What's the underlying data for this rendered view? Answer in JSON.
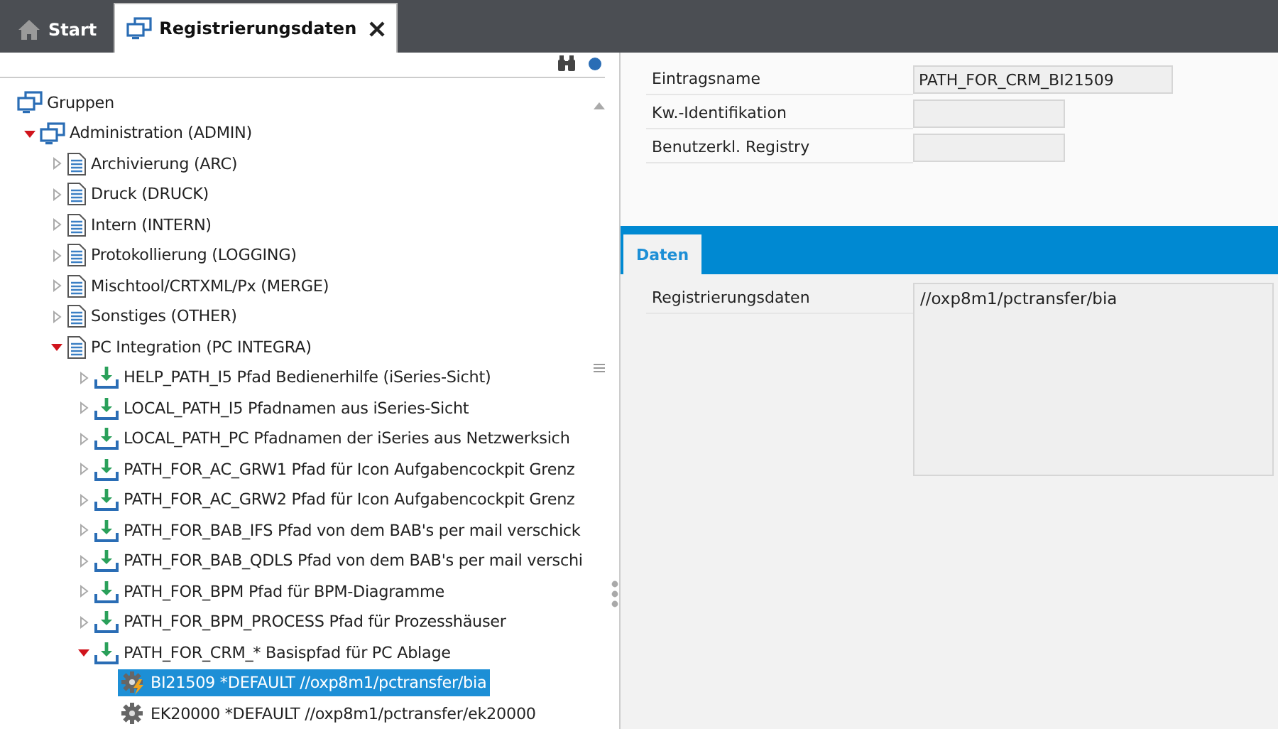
{
  "tabs": [
    {
      "label": "Start",
      "kind": "home",
      "selected": false,
      "closable": false
    },
    {
      "label": "Registrierungsdaten",
      "kind": "group",
      "selected": true,
      "closable": true
    }
  ],
  "tree": [
    {
      "label": "Gruppen",
      "kind": "group",
      "children": [
        {
          "label": "Administration (ADMIN)",
          "kind": "group",
          "expanded": true,
          "children": [
            {
              "label": "Archivierung (ARC)",
              "kind": "doc",
              "expanded": false
            },
            {
              "label": "Druck (DRUCK)",
              "kind": "doc",
              "expanded": false
            },
            {
              "label": "Intern (INTERN)",
              "kind": "doc",
              "expanded": false
            },
            {
              "label": "Protokollierung (LOGGING)",
              "kind": "doc",
              "expanded": false
            },
            {
              "label": "Mischtool/CRTXML/Px (MERGE)",
              "kind": "doc",
              "expanded": false
            },
            {
              "label": "Sonstiges (OTHER)",
              "kind": "doc",
              "expanded": false
            },
            {
              "label": "PC Integration (PC INTEGRA)",
              "kind": "doc",
              "expanded": true,
              "children": [
                {
                  "label": "HELP_PATH_I5 Pfad Bedienerhilfe (iSeries-Sicht)",
                  "kind": "download",
                  "expanded": false
                },
                {
                  "label": "LOCAL_PATH_I5 Pfadnamen aus iSeries-Sicht",
                  "kind": "download",
                  "expanded": false
                },
                {
                  "label": "LOCAL_PATH_PC Pfadnamen der iSeries aus Netzwerksich",
                  "kind": "download",
                  "expanded": false
                },
                {
                  "label": "PATH_FOR_AC_GRW1 Pfad für Icon Aufgabencockpit Grenz",
                  "kind": "download",
                  "expanded": false
                },
                {
                  "label": "PATH_FOR_AC_GRW2 Pfad für Icon Aufgabencockpit Grenz",
                  "kind": "download",
                  "expanded": false
                },
                {
                  "label": "PATH_FOR_BAB_IFS Pfad von dem BAB's per mail verschick",
                  "kind": "download",
                  "expanded": false
                },
                {
                  "label": "PATH_FOR_BAB_QDLS Pfad von dem BAB's per mail verschi",
                  "kind": "download",
                  "expanded": false
                },
                {
                  "label": "PATH_FOR_BPM Pfad für BPM-Diagramme",
                  "kind": "download",
                  "expanded": false
                },
                {
                  "label": "PATH_FOR_BPM_PROCESS Pfad für Prozesshäuser",
                  "kind": "download",
                  "expanded": false
                },
                {
                  "label": "PATH_FOR_CRM_* Basispfad für PC Ablage",
                  "kind": "download",
                  "expanded": true,
                  "children": [
                    {
                      "label": "BI21509 *DEFAULT //oxp8m1/pctransfer/bia",
                      "kind": "gear-active",
                      "selected": true
                    },
                    {
                      "label": "EK20000 *DEFAULT //oxp8m1/pctransfer/ek20000",
                      "kind": "gear",
                      "selected": false
                    }
                  ]
                }
              ]
            }
          ]
        }
      ]
    }
  ],
  "fields": [
    {
      "label": "Eintragsname",
      "value": "PATH_FOR_CRM_BI21509",
      "kind": "wide"
    },
    {
      "label": "Kw.-Identifikation",
      "kind": "narrow"
    },
    {
      "label": "Benutzerkl. Registry",
      "kind": "narrow"
    }
  ],
  "detail_tabs": [
    {
      "label": "Daten",
      "selected": true
    }
  ],
  "detail_fields": [
    {
      "label": "Registrierungsdaten",
      "value": "//oxp8m1/pctransfer/bia"
    }
  ]
}
